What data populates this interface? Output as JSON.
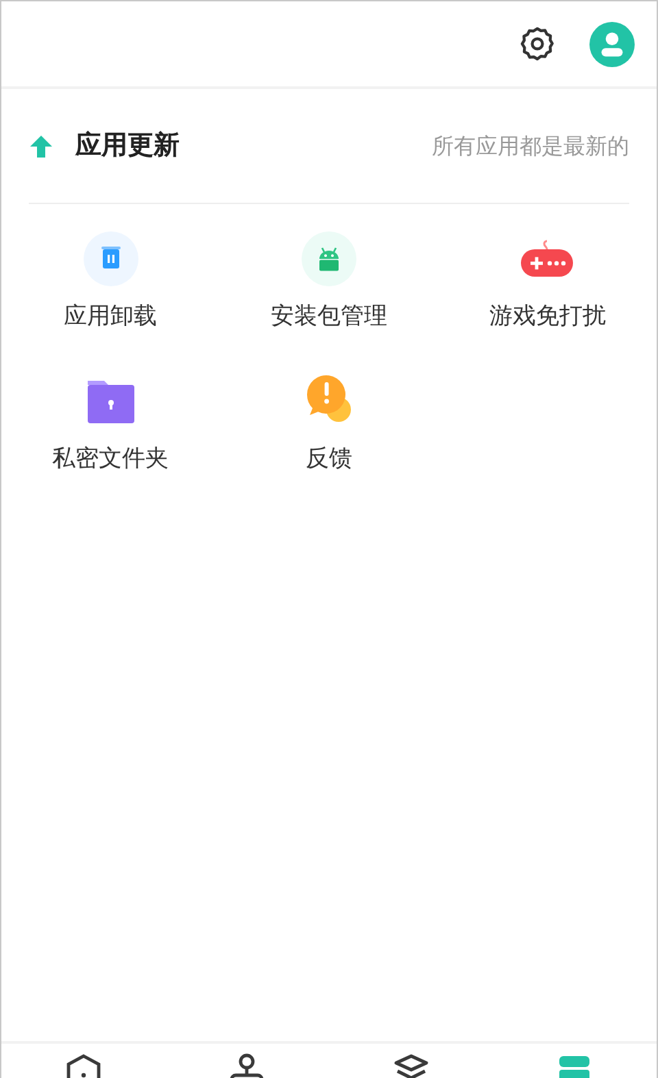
{
  "update": {
    "title": "应用更新",
    "status": "所有应用都是最新的"
  },
  "tools": [
    {
      "kind": "uninstall",
      "label": "应用卸载"
    },
    {
      "kind": "package",
      "label": "安装包管理"
    },
    {
      "kind": "game",
      "label": "游戏免打扰"
    },
    {
      "kind": "folder",
      "label": "私密文件夹"
    },
    {
      "kind": "feedback",
      "label": "反馈"
    }
  ],
  "bottom_nav": [
    {
      "kind": "home",
      "selected": false
    },
    {
      "kind": "person",
      "selected": false
    },
    {
      "kind": "layers",
      "selected": false
    },
    {
      "kind": "tools",
      "selected": true
    }
  ]
}
